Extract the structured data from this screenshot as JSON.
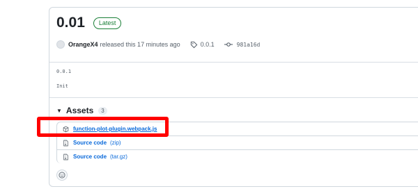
{
  "release": {
    "title": "0.01",
    "badge": "Latest",
    "author": "OrangeX4",
    "released_text": "released this 17 minutes ago",
    "tag": "0.0.1",
    "commit": "981a16d"
  },
  "notes": {
    "version_line": "0.0.1",
    "message_line": "Init"
  },
  "assets": {
    "heading": "Assets",
    "count": "3",
    "items": [
      {
        "name": "function-plot-plugin.webpack.js",
        "ext": "",
        "icon": "package-icon"
      },
      {
        "name": "Source code",
        "ext": "(zip)",
        "icon": "file-zip-icon"
      },
      {
        "name": "Source code",
        "ext": "(tar.gz)",
        "icon": "file-zip-icon"
      }
    ]
  },
  "colors": {
    "link": "#0969da",
    "latest": "#1a7f37",
    "highlight": "#ff0000"
  }
}
